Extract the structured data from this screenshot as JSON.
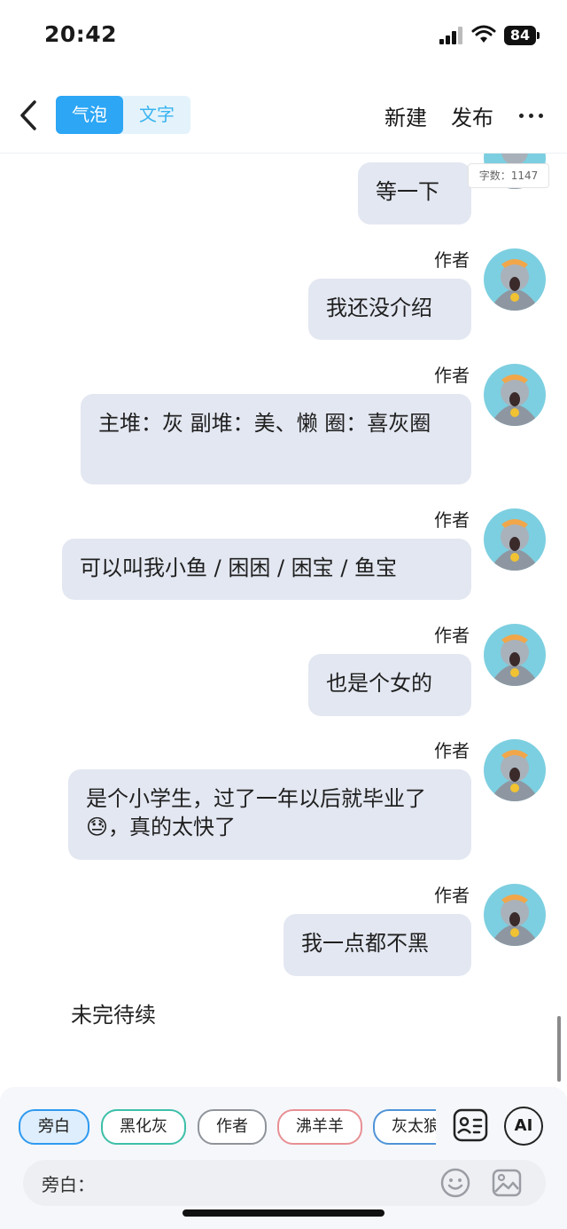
{
  "status_bar": {
    "time": "20:42",
    "battery": "84"
  },
  "top_bar": {
    "segments": [
      "气泡",
      "文字"
    ],
    "new_label": "新建",
    "publish_label": "发布"
  },
  "word_count": "字数：1147",
  "messages": [
    {
      "author": "",
      "text": "等一下"
    },
    {
      "author": "作者",
      "text": "我还没介绍"
    },
    {
      "author": "作者",
      "text": "主堆：灰 副堆：美、懒 圈：喜灰圈"
    },
    {
      "author": "作者",
      "text": "可以叫我小鱼 / 困困 / 困宝 / 鱼宝"
    },
    {
      "author": "作者",
      "text": "也是个女的"
    },
    {
      "author": "作者",
      "text": "是个小学生，过了一年以后就毕业了😓，真的太快了"
    },
    {
      "author": "作者",
      "text": "我一点都不黑"
    }
  ],
  "narration": "未完待续",
  "characters": [
    "旁白",
    "黑化灰",
    "作者",
    "沸羊羊",
    "灰太狼"
  ],
  "ai_label": "AI",
  "input": {
    "label": "旁白："
  }
}
